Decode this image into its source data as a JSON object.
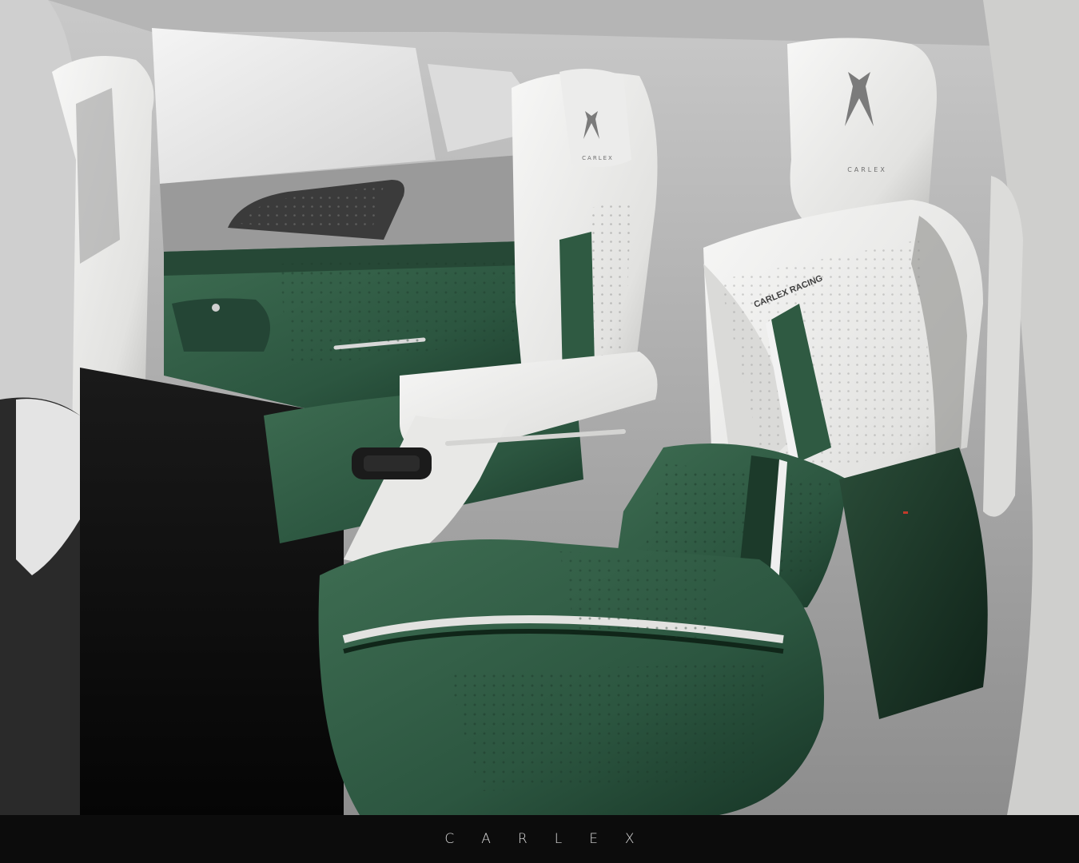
{
  "footer": {
    "brand": "CARLEX"
  },
  "seat_texts": {
    "embroidery": "CARLEX RACING",
    "headrest_right": "CARLEX",
    "headrest_left": "CARLEX"
  },
  "colors": {
    "leather_green": "#2f5a42",
    "leather_white": "#e6e6e4",
    "footer_bg": "#0c0c0c"
  },
  "icons": [
    "crown-logo-icon"
  ]
}
